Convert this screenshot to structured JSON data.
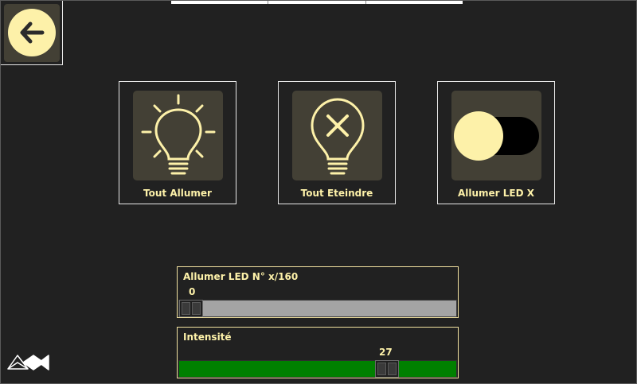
{
  "tiles": [
    {
      "label": "Tout Allumer",
      "icon": "lightbulb-on-icon"
    },
    {
      "label": "Tout Eteindre",
      "icon": "lightbulb-off-icon"
    },
    {
      "label": "Allumer LED X",
      "icon": "toggle-icon"
    }
  ],
  "slider_led": {
    "title": "Allumer LED N° x/160",
    "value": "0",
    "fraction": 0.0
  },
  "slider_intensity": {
    "title": "Intensité",
    "value": "27",
    "fraction": 0.78
  },
  "colors": {
    "background": "#212121",
    "accent": "#fdf1a9",
    "tile_bg": "#434035",
    "track_grey": "#a4a4a4",
    "track_green": "#008000"
  }
}
